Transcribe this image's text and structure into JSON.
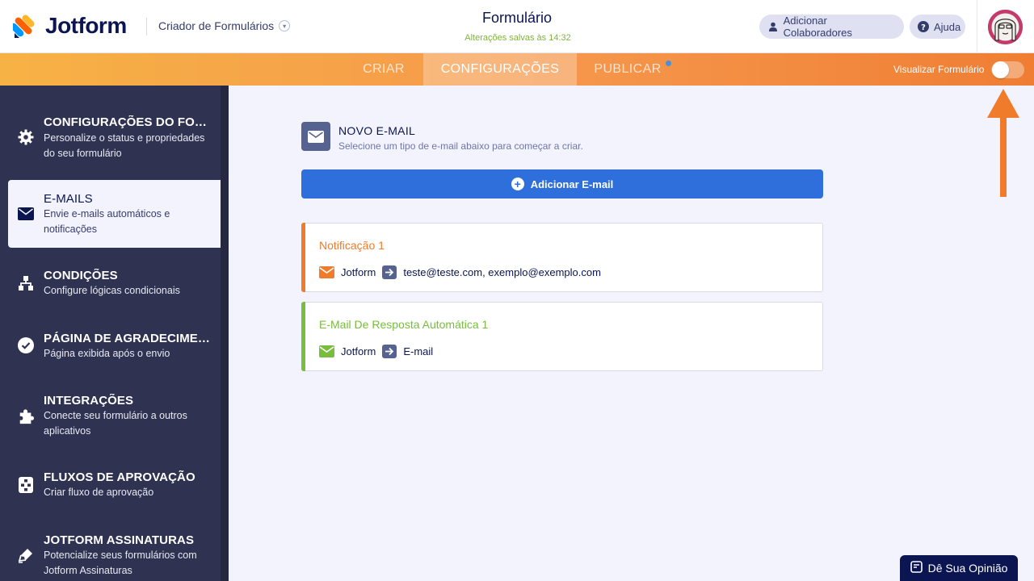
{
  "header": {
    "logo_text": "Jotform",
    "builder_name": "Criador de Formulários",
    "form_title": "Formulário",
    "save_status": "Alterações salvas às 14:32",
    "add_collaborators_label": "Adicionar Colaboradores",
    "help_label": "Ajuda"
  },
  "tabs": [
    {
      "label": "CRIAR",
      "active": false
    },
    {
      "label": "CONFIGURAÇÕES",
      "active": true
    },
    {
      "label": "PUBLICAR",
      "active": false
    }
  ],
  "preview": {
    "label": "Visualizar Formulário",
    "enabled": false
  },
  "sidebar": {
    "items": [
      {
        "title": "CONFIGURAÇÕES DO FORMULÁRIO",
        "desc": "Personalize o status e propriedades do seu formulário",
        "icon": "gear-icon"
      },
      {
        "title": "E-MAILS",
        "desc": "Envie e-mails automáticos e notificações",
        "icon": "envelope-icon",
        "active": true
      },
      {
        "title": "CONDIÇÕES",
        "desc": "Configure lógicas condicionais",
        "icon": "conditions-icon"
      },
      {
        "title": "PÁGINA DE AGRADECIMENTO",
        "desc": "Página exibida após o envio",
        "icon": "check-circle-icon"
      },
      {
        "title": "INTEGRAÇÕES",
        "desc": "Conecte seu formulário a outros aplicativos",
        "icon": "puzzle-icon"
      },
      {
        "title": "FLUXOS DE APROVAÇÃO",
        "desc": "Criar fluxo de aprovação",
        "icon": "approval-flow-icon"
      },
      {
        "title": "JOTFORM ASSINATURAS",
        "desc": "Potencialize seus formulários com Jotform Assinaturas",
        "icon": "pen-icon"
      }
    ]
  },
  "main": {
    "new_email_title": "NOVO E-MAIL",
    "new_email_subtitle": "Selecione um tipo de e-mail abaixo para começar a criar.",
    "add_email_label": "Adicionar E-mail",
    "emails": [
      {
        "title": "Notificação 1",
        "sender": "Jotform",
        "recipient": "teste@teste.com, exemplo@exemplo.com",
        "color": "#f07c2b"
      },
      {
        "title": "E-Mail De Resposta Automática 1",
        "sender": "Jotform",
        "recipient": "E-mail",
        "color": "#78be3c"
      }
    ]
  },
  "feedback_label": "Dê Sua Opinião",
  "colors": {
    "accent_orange": "#ef7e33",
    "primary_blue": "#2e6fdb",
    "sidebar_bg": "#2f3250",
    "navy": "#0a1551"
  }
}
